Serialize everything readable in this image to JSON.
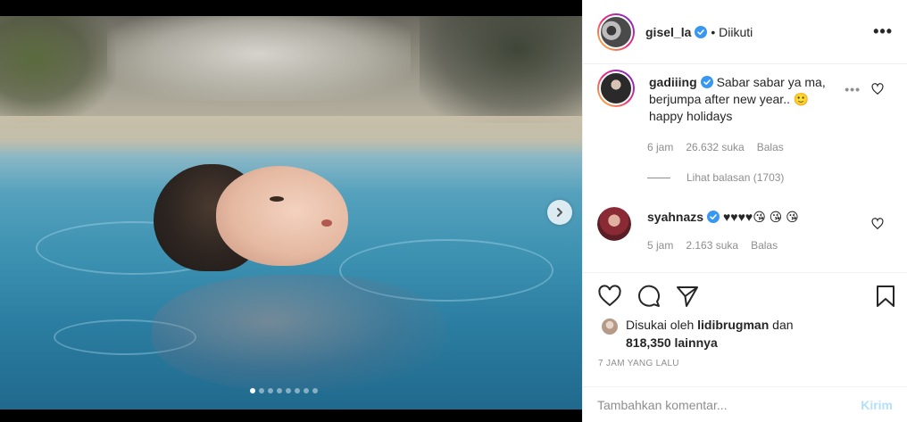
{
  "post": {
    "username": "gisel_la",
    "follow_status": "Diikuti",
    "separator": "•",
    "more_icon": "more-horizontal-icon",
    "time_ago": "7 JAM YANG LALU"
  },
  "carousel": {
    "total_slides": 8,
    "active_slide": 1
  },
  "comments": [
    {
      "username": "gadiiing",
      "verified": true,
      "text": "Sabar sabar ya ma, berjumpa after new year.. 🙂 happy holidays",
      "time": "6 jam",
      "likes": "26.632 suka",
      "reply": "Balas",
      "view_replies": "Lihat balasan (1703)"
    },
    {
      "username": "syahnazs",
      "verified": true,
      "text": "♥♥♥♥😘 😘 😘",
      "time": "5 jam",
      "likes": "2.163 suka",
      "reply": "Balas"
    }
  ],
  "likes": {
    "prefix": "Disukai oleh",
    "user": "lidibrugman",
    "conjunction": "dan",
    "others": "818,350 lainnya"
  },
  "add_comment": {
    "placeholder": "Tambahkan komentar...",
    "post_label": "Kirim"
  },
  "colors": {
    "verified": "#3897f0",
    "text": "#262626",
    "muted": "#8e8e8e",
    "post_disabled": "#b2dffc"
  }
}
